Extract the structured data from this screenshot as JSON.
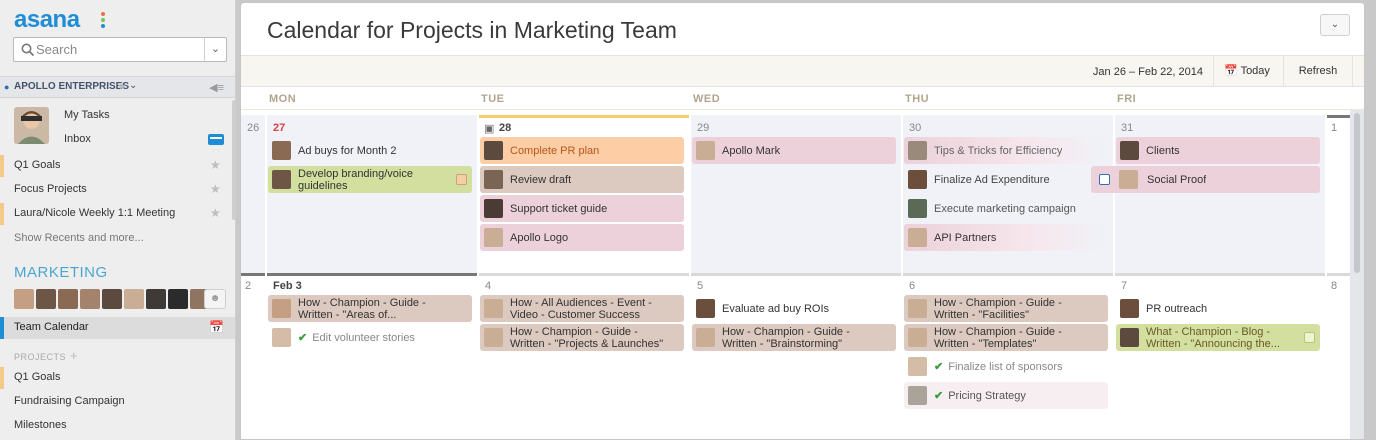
{
  "app": {
    "logo": "asana",
    "logo_dot_colors": [
      "#f26d4b",
      "#7ac653",
      "#1f8dd6"
    ]
  },
  "sidebar": {
    "search_placeholder": "Search",
    "org_name": "APOLLO ENTERPRISES",
    "my_tasks": "My Tasks",
    "inbox": "Inbox",
    "favorites": [
      {
        "label": "Q1 Goals"
      },
      {
        "label": "Focus Projects"
      },
      {
        "label": "Laura/Nicole Weekly 1:1 Meeting"
      }
    ],
    "show_more": "Show Recents and more...",
    "team_title": "MARKETING",
    "team_calendar": "Team Calendar",
    "projects_header": "PROJECTS",
    "projects": [
      {
        "label": "Q1 Goals"
      },
      {
        "label": "Fundraising Campaign"
      },
      {
        "label": "Milestones"
      }
    ]
  },
  "main": {
    "title": "Calendar for Projects in Marketing Team",
    "range": "Jan 26 – Feb 22, 2014",
    "today": "Today",
    "refresh": "Refresh",
    "days": [
      "MON",
      "TUE",
      "WED",
      "THU",
      "FRI"
    ]
  },
  "week1": {
    "sun": "26",
    "mon": "27",
    "tue": "28",
    "wed": "29",
    "thu": "30",
    "fri": "31",
    "sat": "1",
    "tasks": {
      "mon1": "Ad buys for Month 2",
      "mon2": "Develop branding/voice guidelines",
      "tue1": "Complete PR plan",
      "tue2": "Review draft",
      "tue3": "Support ticket guide",
      "tue4": "Apollo Logo",
      "wed1": "Apollo Mark",
      "thu1": "Tips & Tricks for Efficiency",
      "thu2": "Finalize Ad Expenditure",
      "thu3": "Execute marketing campaign",
      "thu4": "API Partners",
      "fri1": "Clients",
      "fri2": "Social Proof"
    }
  },
  "week2": {
    "sun": "2",
    "mon": "Feb 3",
    "tue": "4",
    "wed": "5",
    "thu": "6",
    "fri": "7",
    "sat": "8",
    "tasks": {
      "mon1": "How - Champion - Guide - Written - \"Areas of...",
      "mon2": "Edit volunteer stories",
      "tue1": "How - All Audiences - Event - Video - Customer Success",
      "tue2": "How - Champion - Guide - Written - \"Projects & Launches\"",
      "wed1": "Evaluate ad buy ROIs",
      "wed2": "How - Champion - Guide - Written - \"Brainstorming\"",
      "thu1": "How - Champion - Guide - Written - \"Facilities\"",
      "thu2": "How - Champion - Guide - Written - \"Templates\"",
      "thu3": "Finalize list of sponsors",
      "thu4": "Pricing Strategy",
      "fri1": "PR outreach",
      "fri2": "What - Champion - Blog - Written - \"Announcing the..."
    }
  },
  "colors": {
    "accent": "#1f8dd6",
    "pink_task": "#ecd1da",
    "tan_task": "#dcc9bf",
    "green_task": "#d2df9f",
    "orange_task": "#fdcda6"
  }
}
